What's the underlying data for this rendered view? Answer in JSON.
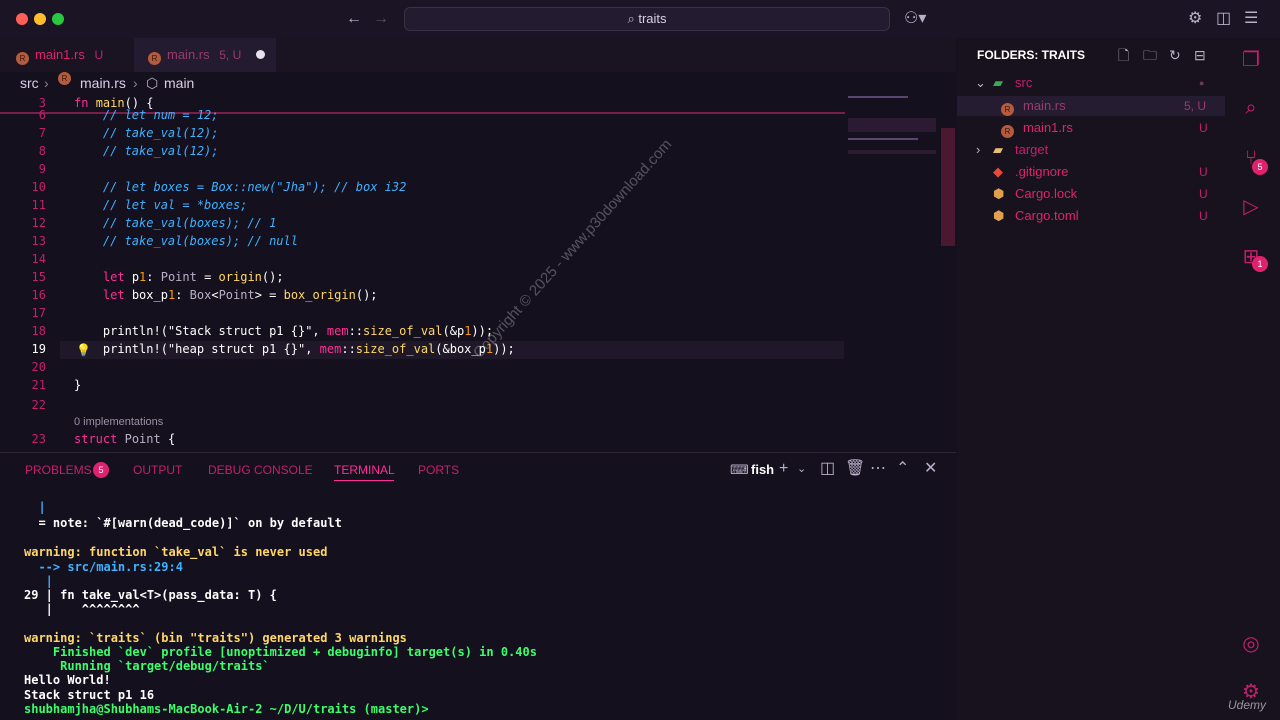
{
  "window": {
    "search_text": "traits"
  },
  "tabs": [
    {
      "label": "main1.rs",
      "status": "U"
    },
    {
      "label": "main.rs",
      "status": "5, U"
    }
  ],
  "breadcrumb": {
    "folder": "src",
    "file": "main.rs",
    "symbol": "main"
  },
  "editor": {
    "lines": [
      {
        "n": "3",
        "code": "fn main() {"
      },
      {
        "n": "6",
        "code": "    // let num = 12;"
      },
      {
        "n": "7",
        "code": "    // take_val(12);"
      },
      {
        "n": "8",
        "code": "    // take_val(12);"
      },
      {
        "n": "9",
        "code": ""
      },
      {
        "n": "10",
        "code": "    // let boxes = Box::new(\"Jha\"); // box i32"
      },
      {
        "n": "11",
        "code": "    // let val = *boxes;"
      },
      {
        "n": "12",
        "code": "    // take_val(boxes); // 1"
      },
      {
        "n": "13",
        "code": "    // take_val(boxes); // null"
      },
      {
        "n": "14",
        "code": ""
      },
      {
        "n": "15",
        "code": "    let p1: Point = origin();"
      },
      {
        "n": "16",
        "code": "    let box_p1: Box<Point> = box_origin();"
      },
      {
        "n": "17",
        "code": ""
      },
      {
        "n": "18",
        "code": "    println!(\"Stack struct p1 {}\", mem::size_of_val(&p1));"
      },
      {
        "n": "19",
        "code": "    println!(\"heap struct p1 {}\", mem::size_of_val(&box_p1));"
      },
      {
        "n": "20",
        "code": ""
      },
      {
        "n": "21",
        "code": "}"
      },
      {
        "n": "22",
        "code": ""
      },
      {
        "n": "23",
        "code": "struct Point {"
      }
    ],
    "implementations": "0 implementations"
  },
  "panel": {
    "tabs": [
      "PROBLEMS",
      "OUTPUT",
      "DEBUG CONSOLE",
      "TERMINAL",
      "PORTS"
    ],
    "problems_count": "5",
    "shell": "fish"
  },
  "terminal": {
    "lines": [
      "  |",
      "  = note: `#[warn(dead_code)]` on by default",
      "",
      "warning: function `take_val` is never used",
      "  --> src/main.rs:29:4",
      "   |",
      "29 | fn take_val<T>(pass_data: T) {",
      "   |    ^^^^^^^^",
      "",
      "warning: `traits` (bin \"traits\") generated 3 warnings",
      "    Finished `dev` profile [unoptimized + debuginfo] target(s) in 0.40s",
      "     Running `target/debug/traits`",
      "Hello World!",
      "Stack struct p1 16",
      "shubhamjha@Shubhams-MacBook-Air-2 ~/D/U/traits (master)> "
    ]
  },
  "explorer": {
    "title": "FOLDERS: TRAITS",
    "items": [
      {
        "label": "src",
        "status": ""
      },
      {
        "label": "main.rs",
        "status": "5, U"
      },
      {
        "label": "main1.rs",
        "status": "U"
      },
      {
        "label": "target",
        "status": ""
      },
      {
        "label": ".gitignore",
        "status": "U"
      },
      {
        "label": "Cargo.lock",
        "status": "U"
      },
      {
        "label": "Cargo.toml",
        "status": "U"
      }
    ]
  },
  "activity": {
    "scm_badge": "5",
    "ext_badge": "1"
  },
  "watermark": "Copyright © 2025 - www.p30download.com",
  "udemy": "Udemy"
}
